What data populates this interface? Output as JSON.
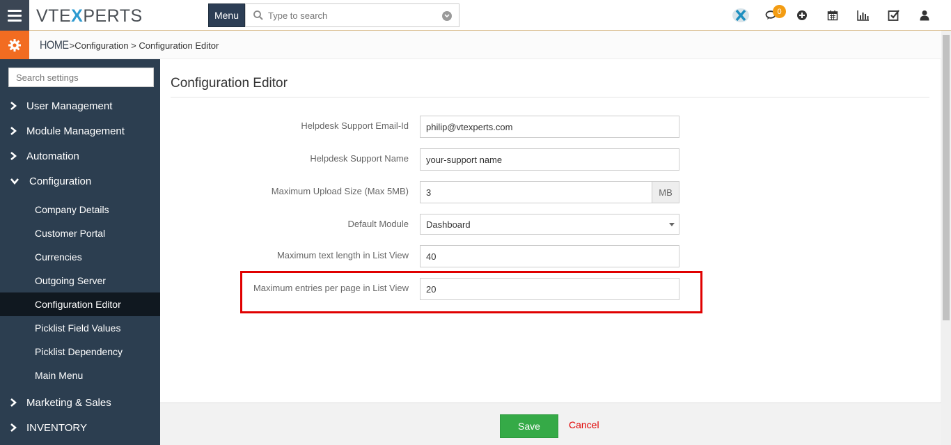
{
  "header": {
    "logo": {
      "pre": "VTE",
      "x": "X",
      "post": "PERTS"
    },
    "menu_label": "Menu",
    "search_placeholder": "Type to search",
    "notification_count": "0",
    "icons": [
      "vtiger-x-icon",
      "chat-icon",
      "plus-circle-icon",
      "calendar-icon",
      "bar-chart-icon",
      "checkbox-icon",
      "user-icon"
    ]
  },
  "breadcrumb": {
    "home": "HOME",
    "sep1": " >",
    "item1": "Configuration",
    "sep2": " > ",
    "item2": "Configuration Editor"
  },
  "sidebar": {
    "search_placeholder": "Search settings",
    "sections": [
      {
        "label": "User Management"
      },
      {
        "label": "Module Management"
      },
      {
        "label": "Automation"
      },
      {
        "label": "Configuration"
      },
      {
        "label": "Marketing & Sales"
      },
      {
        "label": "INVENTORY"
      }
    ],
    "config_items": [
      {
        "label": "Company Details"
      },
      {
        "label": "Customer Portal"
      },
      {
        "label": "Currencies"
      },
      {
        "label": "Outgoing Server"
      },
      {
        "label": "Configuration Editor"
      },
      {
        "label": "Picklist Field Values"
      },
      {
        "label": "Picklist Dependency"
      },
      {
        "label": "Main Menu"
      }
    ]
  },
  "main": {
    "title": "Configuration Editor",
    "fields": [
      {
        "label": "Helpdesk Support Email-Id",
        "value": "philip@vtexperts.com"
      },
      {
        "label": "Helpdesk Support Name",
        "value": "your-support name"
      },
      {
        "label": "Maximum Upload Size (Max 5MB)",
        "value": "3",
        "addon": "MB"
      },
      {
        "label": "Default Module",
        "value": "Dashboard"
      },
      {
        "label": "Maximum text length in List View",
        "value": "40"
      },
      {
        "label": "Maximum entries per page in List View",
        "value": "20"
      }
    ]
  },
  "footer": {
    "save_label": "Save",
    "cancel_label": "Cancel"
  },
  "colors": {
    "sidebar_bg": "#2c3e50",
    "accent_orange": "#f26c21",
    "save_green": "#35aa47",
    "cancel_red": "#e00000",
    "highlight_red": "#e00000"
  }
}
